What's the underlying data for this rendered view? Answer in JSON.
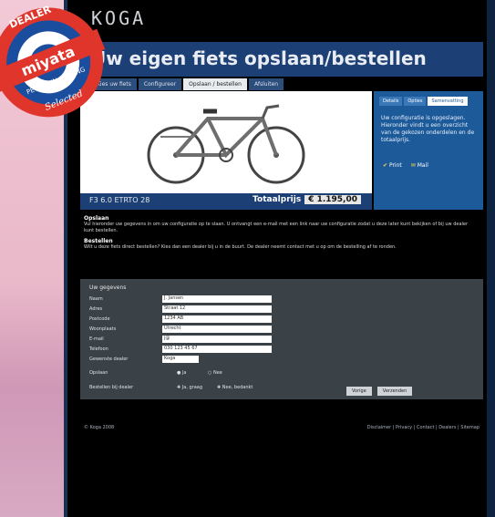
{
  "brand": {
    "logo_text": "KOGA",
    "badge_top": "DEALER",
    "badge_brand": "miyata",
    "badge_tagline": "PEOPLE IN CYCLING",
    "badge_bottom": "Selected"
  },
  "page": {
    "title": "Uw eigen fiets opslaan/bestellen"
  },
  "tabs": [
    {
      "label": "Kies uw fiets"
    },
    {
      "label": "Configureer"
    },
    {
      "label": "Opslaan / bestellen"
    },
    {
      "label": "Afsluiten"
    }
  ],
  "side_panel": {
    "tabs": [
      "Details",
      "Opties",
      "Samenvatting"
    ],
    "text": "Uw configuratie is opgeslagen. Hieronder vindt u een overzicht van de gekozen onderdelen en de totaalprijs.",
    "print_label": "Print",
    "mail_label": "Mail"
  },
  "price_bar": {
    "model": "F3 6.0 ETRTO 28",
    "total_label": "Totaalprijs",
    "total_value": "€ 1.195,00"
  },
  "description": {
    "heading1": "Opslaan",
    "text1": "Vul hieronder uw gegevens in om uw configuratie op te slaan. U ontvangt een e-mail met een link naar uw configuratie zodat u deze later kunt bekijken of bij uw dealer kunt bestellen.",
    "heading2": "Bestellen",
    "text2": "Wilt u deze fiets direct bestellen? Kies dan een dealer bij u in de buurt. De dealer neemt contact met u op om de bestelling af te ronden."
  },
  "form": {
    "title": "Uw gegevens",
    "fields": [
      {
        "label": "Naam",
        "value": "J. Jansen"
      },
      {
        "label": "Adres",
        "value": "Straat 12"
      },
      {
        "label": "Postcode",
        "value": "1234 AB"
      },
      {
        "label": "Woonplaats",
        "value": "Utrecht"
      },
      {
        "label": "E-mail",
        "value": "j@"
      },
      {
        "label": "Telefoon",
        "value": "030 123 45 67"
      },
      {
        "label": "Gewenste dealer",
        "value": "Koga"
      }
    ],
    "radio1_label": "Opslaan",
    "radio1_opt_a": "Ja",
    "radio1_opt_b": "Nee",
    "radio2_label": "Bestellen bij dealer",
    "radio2_opt_a": "Ja, graag",
    "radio2_opt_b": "Nee, bedankt",
    "back_button": "Vorige",
    "send_button": "Verzenden"
  },
  "footer": {
    "left": "© Koga 2008",
    "right": "Disclaimer | Privacy | Contact | Dealers | Sitemap"
  },
  "colors": {
    "title_band": "#1c3f75",
    "blue_panel": "#1d5a9a",
    "form_bg": "#3a4147"
  }
}
